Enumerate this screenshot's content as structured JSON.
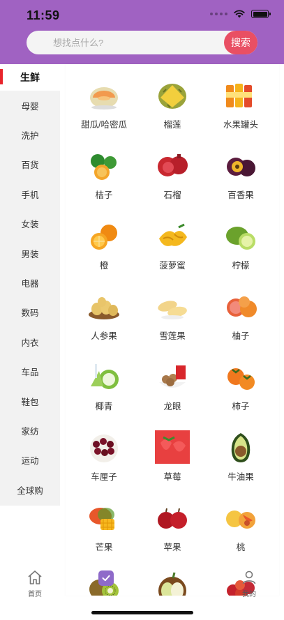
{
  "status_bar": {
    "time": "11:59"
  },
  "search": {
    "placeholder": "想找点什么?",
    "button_label": "搜索"
  },
  "sidebar": {
    "active_index": 0,
    "items": [
      "生鲜",
      "母婴",
      "洗护",
      "百货",
      "手机",
      "女装",
      "男装",
      "电器",
      "数码",
      "内衣",
      "车品",
      "鞋包",
      "家纺",
      "运动",
      "全球购"
    ]
  },
  "products": [
    {
      "label": "甜瓜/哈密瓜",
      "icon": "melon"
    },
    {
      "label": "榴莲",
      "icon": "durian"
    },
    {
      "label": "水果罐头",
      "icon": "canned-fruit"
    },
    {
      "label": "桔子",
      "icon": "tangerine"
    },
    {
      "label": "石榴",
      "icon": "pomegranate"
    },
    {
      "label": "百香果",
      "icon": "passion-fruit"
    },
    {
      "label": "橙",
      "icon": "orange"
    },
    {
      "label": "菠萝蜜",
      "icon": "jackfruit"
    },
    {
      "label": "柠檬",
      "icon": "lemon"
    },
    {
      "label": "人参果",
      "icon": "pepino"
    },
    {
      "label": "雪莲果",
      "icon": "yacon"
    },
    {
      "label": "柚子",
      "icon": "grapefruit"
    },
    {
      "label": "椰青",
      "icon": "coconut"
    },
    {
      "label": "龙眼",
      "icon": "longan"
    },
    {
      "label": "柿子",
      "icon": "persimmon"
    },
    {
      "label": "车厘子",
      "icon": "cherry"
    },
    {
      "label": "草莓",
      "icon": "strawberry"
    },
    {
      "label": "牛油果",
      "icon": "avocado"
    },
    {
      "label": "芒果",
      "icon": "mango"
    },
    {
      "label": "苹果",
      "icon": "apple"
    },
    {
      "label": "桃",
      "icon": "peach"
    },
    {
      "label": "",
      "icon": "kiwi"
    },
    {
      "label": "",
      "icon": "pear"
    },
    {
      "label": "",
      "icon": "red-apples"
    }
  ],
  "tabbar": {
    "home_label": "首页",
    "me_label": "我的"
  },
  "colors": {
    "header": "#a062c2",
    "search_button": "#e94f63",
    "active_marker": "#e8242b"
  }
}
